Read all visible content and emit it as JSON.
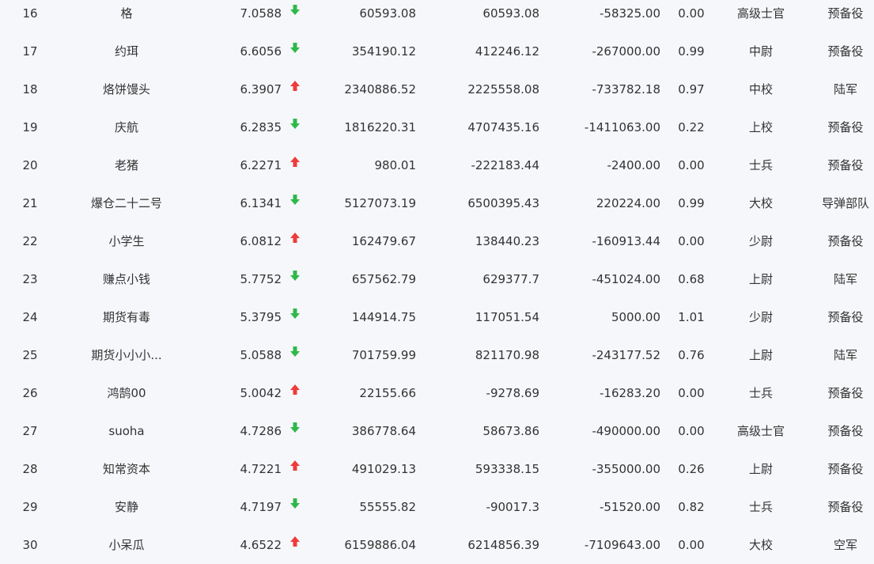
{
  "colors": {
    "background": "#f5f7fa",
    "text": "#333333",
    "up": "#ee3b3b",
    "down": "#2fb84a"
  },
  "rows": [
    {
      "rank": "16",
      "name": "格",
      "score": "7.0588",
      "trend": "down",
      "v1": "60593.08",
      "v2": "60593.08",
      "v3": "-58325.00",
      "ratio": "0.00",
      "title": "高级士官",
      "branch": "预备役"
    },
    {
      "rank": "17",
      "name": "约珥",
      "score": "6.6056",
      "trend": "down",
      "v1": "354190.12",
      "v2": "412246.12",
      "v3": "-267000.00",
      "ratio": "0.99",
      "title": "中尉",
      "branch": "预备役"
    },
    {
      "rank": "18",
      "name": "烙饼馒头",
      "score": "6.3907",
      "trend": "up",
      "v1": "2340886.52",
      "v2": "2225558.08",
      "v3": "-733782.18",
      "ratio": "0.97",
      "title": "中校",
      "branch": "陆军"
    },
    {
      "rank": "19",
      "name": "庆航",
      "score": "6.2835",
      "trend": "down",
      "v1": "1816220.31",
      "v2": "4707435.16",
      "v3": "-1411063.00",
      "ratio": "0.22",
      "title": "上校",
      "branch": "预备役"
    },
    {
      "rank": "20",
      "name": "老猪",
      "score": "6.2271",
      "trend": "up",
      "v1": "980.01",
      "v2": "-222183.44",
      "v3": "-2400.00",
      "ratio": "0.00",
      "title": "士兵",
      "branch": "预备役"
    },
    {
      "rank": "21",
      "name": "爆仓二十二号",
      "score": "6.1341",
      "trend": "down",
      "v1": "5127073.19",
      "v2": "6500395.43",
      "v3": "220224.00",
      "ratio": "0.99",
      "title": "大校",
      "branch": "导弹部队"
    },
    {
      "rank": "22",
      "name": "小学生",
      "score": "6.0812",
      "trend": "up",
      "v1": "162479.67",
      "v2": "138440.23",
      "v3": "-160913.44",
      "ratio": "0.00",
      "title": "少尉",
      "branch": "预备役"
    },
    {
      "rank": "23",
      "name": "赚点小钱",
      "score": "5.7752",
      "trend": "down",
      "v1": "657562.79",
      "v2": "629377.7",
      "v3": "-451024.00",
      "ratio": "0.68",
      "title": "上尉",
      "branch": "陆军"
    },
    {
      "rank": "24",
      "name": "期货有毒",
      "score": "5.3795",
      "trend": "down",
      "v1": "144914.75",
      "v2": "117051.54",
      "v3": "5000.00",
      "ratio": "1.01",
      "title": "少尉",
      "branch": "预备役"
    },
    {
      "rank": "25",
      "name": "期货小小小...",
      "score": "5.0588",
      "trend": "down",
      "v1": "701759.99",
      "v2": "821170.98",
      "v3": "-243177.52",
      "ratio": "0.76",
      "title": "上尉",
      "branch": "陆军"
    },
    {
      "rank": "26",
      "name": "鸿鹄00",
      "score": "5.0042",
      "trend": "up",
      "v1": "22155.66",
      "v2": "-9278.69",
      "v3": "-16283.20",
      "ratio": "0.00",
      "title": "士兵",
      "branch": "预备役"
    },
    {
      "rank": "27",
      "name": "suoha",
      "score": "4.7286",
      "trend": "down",
      "v1": "386778.64",
      "v2": "58673.86",
      "v3": "-490000.00",
      "ratio": "0.00",
      "title": "高级士官",
      "branch": "预备役"
    },
    {
      "rank": "28",
      "name": "知常资本",
      "score": "4.7221",
      "trend": "up",
      "v1": "491029.13",
      "v2": "593338.15",
      "v3": "-355000.00",
      "ratio": "0.26",
      "title": "上尉",
      "branch": "预备役"
    },
    {
      "rank": "29",
      "name": "安静",
      "score": "4.7197",
      "trend": "down",
      "v1": "55555.82",
      "v2": "-90017.3",
      "v3": "-51520.00",
      "ratio": "0.82",
      "title": "士兵",
      "branch": "预备役"
    },
    {
      "rank": "30",
      "name": "小呆瓜",
      "score": "4.6522",
      "trend": "up",
      "v1": "6159886.04",
      "v2": "6214856.39",
      "v3": "-7109643.00",
      "ratio": "0.00",
      "title": "大校",
      "branch": "空军"
    }
  ]
}
